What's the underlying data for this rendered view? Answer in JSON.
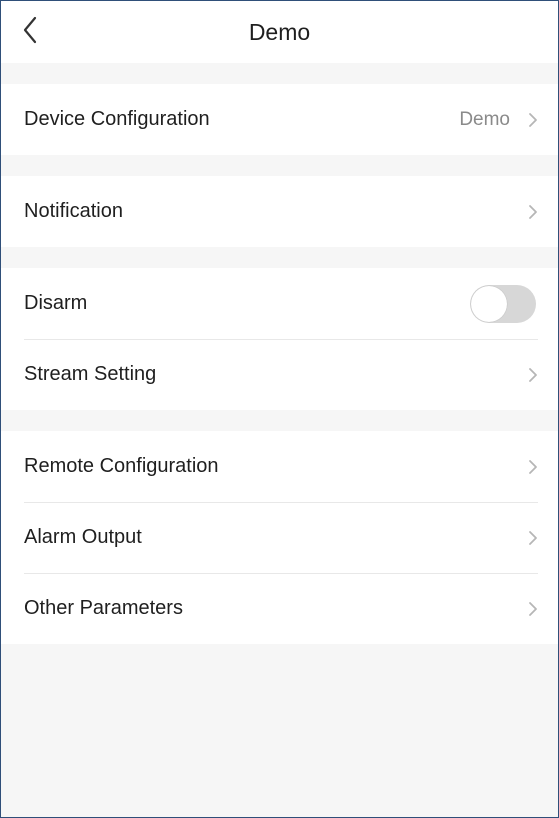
{
  "header": {
    "title": "Demo",
    "back_icon": "chevron-left-icon"
  },
  "sections": [
    {
      "rows": [
        {
          "label": "Device Configuration",
          "value": "Demo",
          "type": "nav"
        }
      ]
    },
    {
      "rows": [
        {
          "label": "Notification",
          "type": "nav"
        }
      ]
    },
    {
      "rows": [
        {
          "label": "Disarm",
          "type": "toggle",
          "toggle_on": false
        },
        {
          "label": "Stream Setting",
          "type": "nav"
        }
      ]
    },
    {
      "rows": [
        {
          "label": "Remote Configuration",
          "type": "nav"
        },
        {
          "label": "Alarm Output",
          "type": "nav"
        },
        {
          "label": "Other Parameters",
          "type": "nav"
        }
      ]
    }
  ],
  "colors": {
    "background": "#f6f6f6",
    "surface": "#ffffff",
    "text": "#1f1f1f",
    "secondary_text": "#8a8a8a",
    "toggle_off": "#d7d7d7"
  }
}
